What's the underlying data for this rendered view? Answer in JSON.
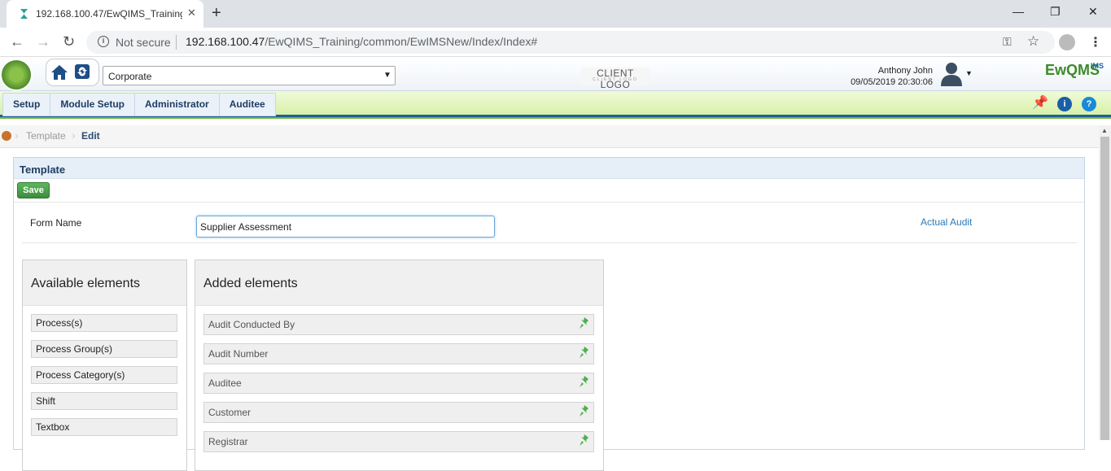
{
  "browser": {
    "tab_title": "192.168.100.47/EwQIMS_Training",
    "not_secure": "Not secure",
    "url_host": "192.168.100.47",
    "url_path": "/EwQIMS_Training/common/EwIMSNew/Index/Index#"
  },
  "header": {
    "corporate": "Corporate",
    "client_logo": "CLIENT LOGO",
    "client_logo_sub": "CLIENT LOGO",
    "user_name": "Anthony John",
    "datetime": "09/05/2019 20:30:06",
    "brand": "EwQMS",
    "brand_sup": "IMS"
  },
  "menu": {
    "items": [
      "Setup",
      "Module Setup",
      "Administrator",
      "Auditee"
    ]
  },
  "breadcrumb": {
    "template": "Template",
    "edit": "Edit"
  },
  "panel": {
    "title": "Template",
    "save_label": "Save",
    "form_name_label": "Form Name",
    "form_name_value": "Supplier Assessment",
    "actual_audit_link": "Actual Audit"
  },
  "available": {
    "title": "Available elements",
    "items": [
      "Process(s)",
      "Process Group(s)",
      "Process Category(s)",
      "Shift",
      "Textbox"
    ]
  },
  "added": {
    "title": "Added elements",
    "items": [
      "Audit Conducted By",
      "Audit Number",
      "Auditee",
      "Customer",
      "Registrar"
    ]
  },
  "colors": {
    "accent_blue": "#1f5f9a",
    "menu_green": "#d8f0a8",
    "save_green": "#4cae4c",
    "link_blue": "#2a7ab8"
  }
}
